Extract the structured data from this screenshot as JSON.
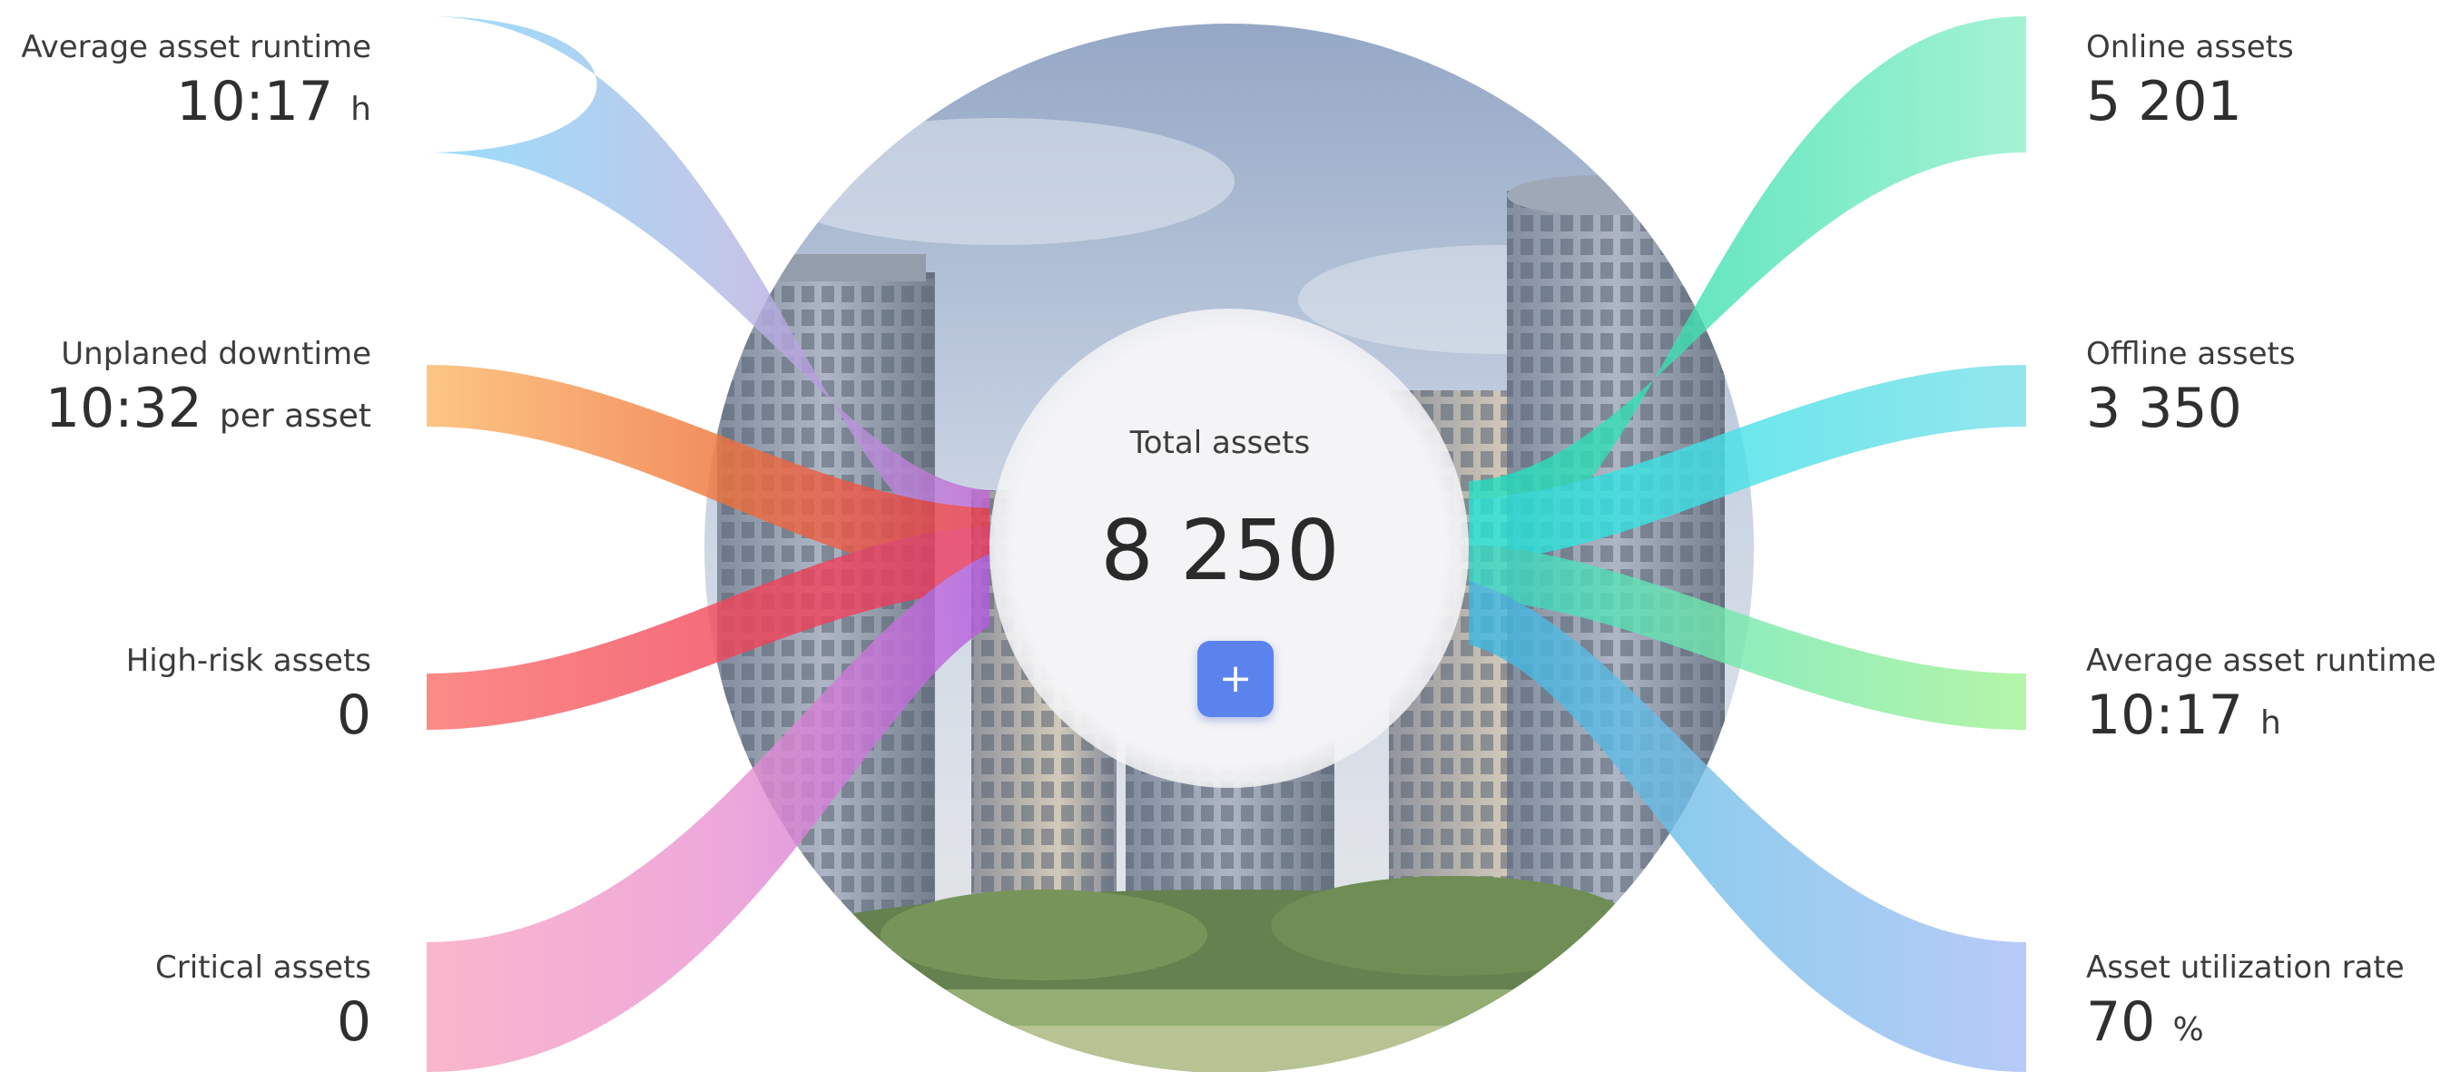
{
  "center": {
    "label": "Total assets",
    "value": "8 250",
    "add_symbol": "+"
  },
  "left_metrics": [
    {
      "label": "Average asset runtime",
      "value": "10:17",
      "unit": "h",
      "color": "#7ed6fb"
    },
    {
      "label": "Unplaned downtime",
      "value": "10:32",
      "unit": "per asset",
      "color": "#fdb866"
    },
    {
      "label": "High-risk assets",
      "value": "0",
      "unit": "",
      "color": "#fb6f6a"
    },
    {
      "label": "Critical assets",
      "value": "0",
      "unit": "",
      "color": "#f9a4be"
    }
  ],
  "right_metrics": [
    {
      "label": "Online assets",
      "value": "5 201",
      "unit": "",
      "color": "#8df0c8"
    },
    {
      "label": "Offline assets",
      "value": "3 350",
      "unit": "",
      "color": "#7adfe9"
    },
    {
      "label": "Average asset runtime",
      "value": "10:17",
      "unit": "h",
      "color": "#a2f394"
    },
    {
      "label": "Asset utilization rate",
      "value": "70",
      "unit": "%",
      "color": "#a6bdf6"
    }
  ],
  "colors": {
    "button": "#5b83ee",
    "flow_left_mix": "#c466d6",
    "flow_right_mix": "#1ee0c2"
  },
  "icons": {
    "add": "plus-icon",
    "background": "city-buildings-photo"
  }
}
